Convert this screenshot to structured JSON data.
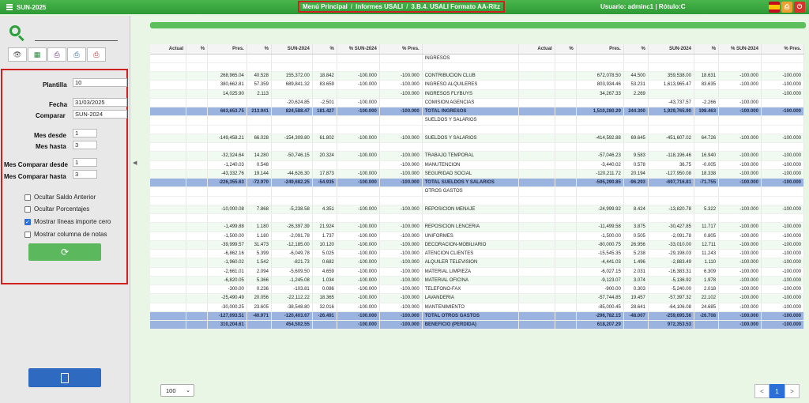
{
  "app": {
    "title": "SUN-2025"
  },
  "breadcrumb": [
    "Menú Principal",
    "Informes USALI",
    "3.B.4. USALI Formato AA-Ritz"
  ],
  "user_label": "Usuario: adminc1 | Rótulo:C",
  "toolbar_icons": [
    "eye-icon",
    "excel-icon",
    "printer-icon",
    "printer-alt-icon",
    "printer-red-icon"
  ],
  "form": {
    "plantilla": {
      "label": "Plantilla",
      "value": "10"
    },
    "fecha": {
      "label": "Fecha",
      "value": "31/03/2025"
    },
    "comparar": {
      "label": "Comparar",
      "value": "SUN-2024"
    },
    "mes_desde": {
      "label": "Mes desde",
      "value": "1"
    },
    "mes_hasta": {
      "label": "Mes hasta",
      "value": "3"
    },
    "mes_comp_desde": {
      "label": "Mes Comparar desde",
      "value": "1"
    },
    "mes_comp_hasta": {
      "label": "Mes Comparar hasta",
      "value": "3"
    },
    "checks": [
      {
        "label": "Ocultar Saldo Anterior",
        "checked": false
      },
      {
        "label": "Ocultar Porcentajes",
        "checked": false
      },
      {
        "label": "Mostrar líneas importe cero",
        "checked": true
      },
      {
        "label": "Mostrar columna de notas",
        "checked": false
      }
    ]
  },
  "table": {
    "headers": [
      "Actual",
      "%",
      "Pres.",
      "%",
      "SUN-2024",
      "%",
      "% SUN-2024",
      "% Pres.",
      "",
      "Actual",
      "%",
      "Pres.",
      "%",
      "SUN-2024",
      "%",
      "% SUN-2024",
      "% Pres."
    ],
    "rows": [
      {
        "t": "sec",
        "c": [
          "",
          "",
          "",
          "",
          "",
          "",
          "",
          "",
          "INGRESOS",
          "",
          "",
          "",
          "",
          "",
          "",
          "",
          ""
        ]
      },
      {
        "t": "n",
        "c": [
          "",
          "",
          "",
          "",
          "",
          "",
          "",
          "",
          "",
          "",
          "",
          "",
          "",
          "",
          "",
          "",
          ""
        ]
      },
      {
        "t": "alt",
        "c": [
          "",
          "",
          "268,965.04",
          "40.528",
          "155,372.00",
          "18.842",
          "-100.000",
          "-100.000",
          "CONTRIBUCION CLUB",
          "",
          "",
          "672,078.50",
          "44.500",
          "359,538.00",
          "18.631",
          "-100.000",
          "-100.000"
        ]
      },
      {
        "t": "n",
        "c": [
          "",
          "",
          "380,662.81",
          "57.359",
          "689,841.32",
          "83.659",
          "-100.000",
          "-100.000",
          "INGRESO ALQUILERES",
          "",
          "",
          "803,934.46",
          "53.231",
          "1,613,965.47",
          "83.635",
          "-100.000",
          "-100.000"
        ]
      },
      {
        "t": "alt",
        "c": [
          "",
          "",
          "14,025.90",
          "2.113",
          "",
          "",
          "",
          "-100.000",
          "INGRESOS FLYBUYS",
          "",
          "",
          "34,267.33",
          "2.269",
          "",
          "",
          "",
          "-100.000"
        ]
      },
      {
        "t": "n",
        "c": [
          "",
          "",
          "",
          "",
          "-20,624.85",
          "-2.501",
          "-100.000",
          "",
          "COMISION AGENCIAS",
          "",
          "",
          "",
          "",
          "-43,737.57",
          "-2.266",
          "-100.000",
          ""
        ]
      },
      {
        "t": "tot",
        "c": [
          "",
          "",
          "663,653.75",
          "213.941",
          "824,588.47",
          "181.427",
          "-100.000",
          "-100.000",
          "TOTAL INGRESOS",
          "",
          "",
          "1,510,280.29",
          "244.300",
          "1,929,765.90",
          "198.463",
          "-100.000",
          "-100.000"
        ]
      },
      {
        "t": "sec",
        "c": [
          "",
          "",
          "",
          "",
          "",
          "",
          "",
          "",
          "SUELDOS Y SALARIOS",
          "",
          "",
          "",
          "",
          "",
          "",
          "",
          ""
        ]
      },
      {
        "t": "n",
        "c": [
          "",
          "",
          "",
          "",
          "",
          "",
          "",
          "",
          "",
          "",
          "",
          "",
          "",
          "",
          "",
          "",
          ""
        ]
      },
      {
        "t": "alt",
        "c": [
          "",
          "",
          "-149,458.21",
          "66.028",
          "-154,309.80",
          "61.802",
          "-100.000",
          "-100.000",
          "SUELDOS Y SALARIOS",
          "",
          "",
          "-414,592.88",
          "69.645",
          "-451,607.02",
          "64.726",
          "-100.000",
          "-100.000"
        ]
      },
      {
        "t": "n",
        "c": [
          "",
          "",
          "",
          "",
          "",
          "",
          "",
          "",
          "",
          "",
          "",
          "",
          "",
          "",
          "",
          "",
          ""
        ]
      },
      {
        "t": "alt",
        "c": [
          "",
          "",
          "-32,324.64",
          "14.280",
          "-50,746.15",
          "20.324",
          "-100.000",
          "-100.000",
          "TRABAJO TEMPORAL",
          "",
          "",
          "-57,046.23",
          "9.583",
          "-118,196.46",
          "16.940",
          "-100.000",
          "-100.000"
        ]
      },
      {
        "t": "n",
        "c": [
          "",
          "",
          "-1,240.03",
          "0.548",
          "",
          "",
          "",
          "-100.000",
          "MANUTENCION",
          "",
          "",
          "-3,440.02",
          "0.578",
          "36.75",
          "-0.005",
          "-100.000",
          "-100.000"
        ]
      },
      {
        "t": "alt",
        "c": [
          "",
          "",
          "-43,332.76",
          "19.144",
          "-44,626.30",
          "17.873",
          "-100.000",
          "-100.000",
          "SEGURIDAD SOCIAL",
          "",
          "",
          "-120,211.72",
          "20.194",
          "-127,950.08",
          "18.338",
          "-100.000",
          "-100.000"
        ]
      },
      {
        "t": "tot",
        "c": [
          "",
          "",
          "-226,355.63",
          "-72.970",
          "-249,682.25",
          "-54.935",
          "-100.000",
          "-100.000",
          "TOTAL SUELDOS Y SALARIOS",
          "",
          "",
          "-595,290.85",
          "-96.293",
          "-697,716.81",
          "-71.755",
          "-100.000",
          "-100.000"
        ]
      },
      {
        "t": "sec",
        "c": [
          "",
          "",
          "",
          "",
          "",
          "",
          "",
          "",
          "OTROS GASTOS",
          "",
          "",
          "",
          "",
          "",
          "",
          "",
          ""
        ]
      },
      {
        "t": "n",
        "c": [
          "",
          "",
          "",
          "",
          "",
          "",
          "",
          "",
          "",
          "",
          "",
          "",
          "",
          "",
          "",
          "",
          ""
        ]
      },
      {
        "t": "alt",
        "c": [
          "",
          "",
          "-10,000.08",
          "7.868",
          "-5,238.58",
          "4.351",
          "-100.000",
          "-100.000",
          "REPOSICION MENAJE",
          "",
          "",
          "-24,999.92",
          "8.424",
          "-13,820.78",
          "5.322",
          "-100.000",
          "-100.000"
        ]
      },
      {
        "t": "n",
        "c": [
          "",
          "",
          "",
          "",
          "",
          "",
          "",
          "",
          "",
          "",
          "",
          "",
          "",
          "",
          "",
          "",
          ""
        ]
      },
      {
        "t": "alt",
        "c": [
          "",
          "",
          "-1,499.88",
          "1.180",
          "-26,397.39",
          "21.924",
          "-100.000",
          "-100.000",
          "REPOSICION LENCERIA",
          "",
          "",
          "-11,499.58",
          "3.875",
          "-30,427.85",
          "11.717",
          "-100.000",
          "-100.000"
        ]
      },
      {
        "t": "n",
        "c": [
          "",
          "",
          "-1,500.00",
          "1.180",
          "-2,091.78",
          "1.737",
          "-100.000",
          "-100.000",
          "UNIFORMES",
          "",
          "",
          "-1,500.00",
          "0.505",
          "-2,091.78",
          "0.805",
          "-100.000",
          "-100.000"
        ]
      },
      {
        "t": "alt",
        "c": [
          "",
          "",
          "-39,999.57",
          "31.473",
          "-12,185.00",
          "10.120",
          "-100.000",
          "-100.000",
          "DECORACION-MOBILIARIO",
          "",
          "",
          "-80,000.75",
          "26.956",
          "-33,010.00",
          "12.711",
          "-100.000",
          "-100.000"
        ]
      },
      {
        "t": "n",
        "c": [
          "",
          "",
          "-6,862.16",
          "5.399",
          "-6,049.78",
          "5.025",
          "-100.000",
          "-100.000",
          "ATENCION CLIENTES",
          "",
          "",
          "-15,545.35",
          "5.238",
          "-29,198.03",
          "11.243",
          "-100.000",
          "-100.000"
        ]
      },
      {
        "t": "alt",
        "c": [
          "",
          "",
          "-1,960.02",
          "1.542",
          "-821.73",
          "0.682",
          "-100.000",
          "-100.000",
          "ALQUILER TELEVISION",
          "",
          "",
          "-4,441.03",
          "1.496",
          "-2,883.49",
          "1.110",
          "-100.000",
          "-100.000"
        ]
      },
      {
        "t": "n",
        "c": [
          "",
          "",
          "-2,661.01",
          "2.094",
          "-5,609.50",
          "4.659",
          "-100.000",
          "-100.000",
          "MATERIAL LIMPIEZA",
          "",
          "",
          "-6,027.15",
          "2.031",
          "-16,383.31",
          "6.309",
          "-100.000",
          "-100.000"
        ]
      },
      {
        "t": "alt",
        "c": [
          "",
          "",
          "-6,820.05",
          "5.366",
          "-1,245.08",
          "1.034",
          "-100.000",
          "-100.000",
          "MATERIAL OFICINA",
          "",
          "",
          "-9,123.07",
          "3.074",
          "-5,136.92",
          "1.978",
          "-100.000",
          "-100.000"
        ]
      },
      {
        "t": "n",
        "c": [
          "",
          "",
          "-300.00",
          "0.236",
          "-103.81",
          "0.086",
          "-100.000",
          "-100.000",
          "TELEFONO-FAX",
          "",
          "",
          "-900.00",
          "0.303",
          "-5,240.00",
          "2.018",
          "-100.000",
          "-100.000"
        ]
      },
      {
        "t": "alt",
        "c": [
          "",
          "",
          "-25,490.49",
          "20.056",
          "-22,112.22",
          "18.365",
          "-100.000",
          "-100.000",
          "LAVANDERIA",
          "",
          "",
          "-57,744.85",
          "19.457",
          "-57,397.32",
          "22.102",
          "-100.000",
          "-100.000"
        ]
      },
      {
        "t": "n",
        "c": [
          "",
          "",
          "-30,000.25",
          "23.605",
          "-38,548.80",
          "32.016",
          "-100.000",
          "-100.000",
          "MANTENIMIENTO",
          "",
          "",
          "-85,000.45",
          "28.641",
          "-64,106.08",
          "24.685",
          "-100.000",
          "-100.000"
        ]
      },
      {
        "t": "tot",
        "c": [
          "",
          "",
          "-127,093.51",
          "-40.971",
          "-120,403.67",
          "-26.491",
          "-100.000",
          "-100.000",
          "TOTAL OTROS GASTOS",
          "",
          "",
          "-296,782.15",
          "-48.007",
          "-259,695.56",
          "-26.708",
          "-100.000",
          "-100.000"
        ]
      },
      {
        "t": "tot",
        "c": [
          "",
          "",
          "310,204.61",
          "",
          "454,502.55",
          "",
          "-100.000",
          "-100.000",
          "BENEFICIO (PERDIDA)",
          "",
          "",
          "618,207.29",
          "",
          "972,353.53",
          "",
          "-100.000",
          "-100.000"
        ]
      }
    ]
  },
  "page_size": "100",
  "pagination": {
    "prev": "<",
    "current": "1",
    "next": ">"
  }
}
